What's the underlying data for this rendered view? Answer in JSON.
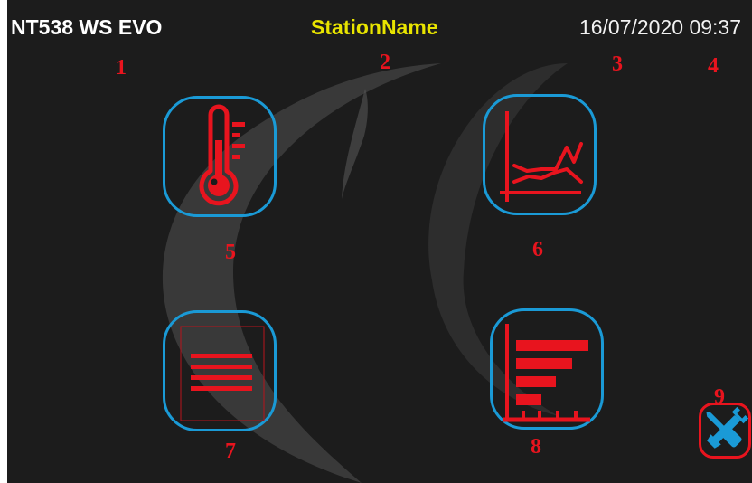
{
  "header": {
    "device_name": "NT538 WS EVO",
    "station_name": "StationName",
    "datetime": "16/07/2020 09:37"
  },
  "callouts": [
    "1",
    "2",
    "3",
    "4",
    "5",
    "6",
    "7",
    "8",
    "9"
  ],
  "tiles": [
    {
      "icon": "thermometer-icon"
    },
    {
      "icon": "line-chart-icon"
    },
    {
      "icon": "list-icon"
    },
    {
      "icon": "bar-chart-icon"
    }
  ],
  "settings": {
    "icon": "wrench-screwdriver-icon"
  },
  "colors": {
    "background": "#1c1c1c",
    "tile_border": "#1a9ad6",
    "icon_red": "#e8141e",
    "station_name": "#e8e400",
    "settings_icon": "#1a9ad6",
    "swoosh": "#666666"
  }
}
